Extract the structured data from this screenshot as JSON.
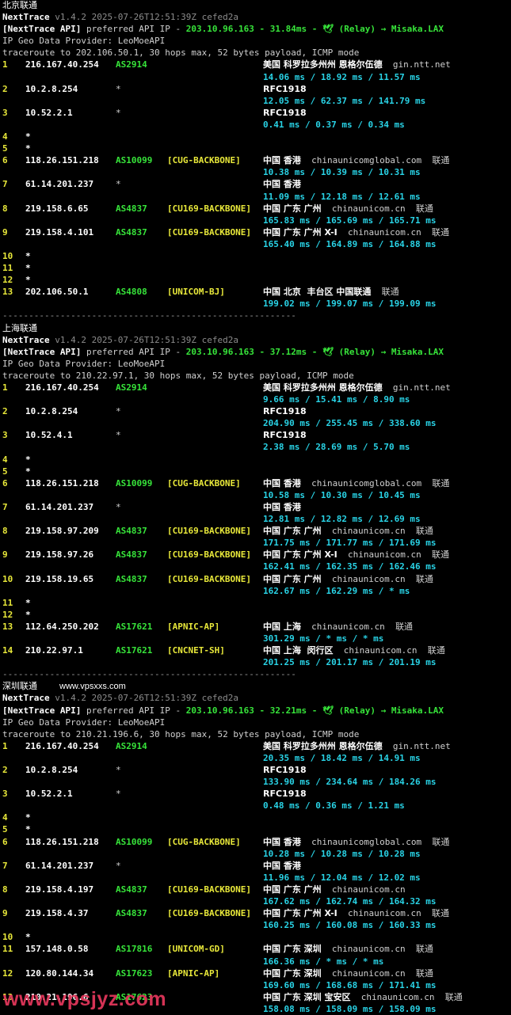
{
  "sections": [
    {
      "title": "北京联通",
      "version_name": "NextTrace",
      "version": "v1.4.2 2025-07-26T12:51:39Z cefed2a",
      "api_tag": "[NextTrace API]",
      "api_text": " preferred API IP - ",
      "api_ip": "203.10.96.163",
      "api_dash": " - ",
      "api_latency": "31.84ms",
      "api_relay": "🕊 (Relay) → Misaka.LAX",
      "geo_provider": "IP Geo Data Provider: LeoMoeAPI",
      "traceroute": "traceroute to 202.106.50.1, 30 hops max, 52 bytes payload, ICMP mode",
      "hops": [
        {
          "n": "1",
          "ip": "216.167.40.254",
          "asn": "AS2914",
          "tag": "",
          "geo": "美国 科罗拉多州州 恩格尔伍德",
          "domain": "gin.ntt.net",
          "isp": "",
          "rtt": "14.06 ms / 18.92 ms / 11.57 ms"
        },
        {
          "n": "2",
          "ip": "10.2.8.254",
          "asn": "*",
          "tag": "",
          "geo": "RFC1918",
          "domain": "",
          "isp": "",
          "rtt": "12.05 ms / 62.37 ms / 141.79 ms"
        },
        {
          "n": "3",
          "ip": "10.52.2.1",
          "asn": "*",
          "tag": "",
          "geo": "RFC1918",
          "domain": "",
          "isp": "",
          "rtt": "0.41 ms / 0.37 ms / 0.34 ms"
        },
        {
          "n": "4",
          "ip": "*"
        },
        {
          "n": "5",
          "ip": "*"
        },
        {
          "n": "6",
          "ip": "118.26.151.218",
          "asn": "AS10099",
          "tag": "[CUG-BACKBONE]",
          "geo": "中国 香港",
          "domain": "chinaunicomglobal.com",
          "isp": "联通",
          "rtt": "10.38 ms / 10.39 ms / 10.31 ms"
        },
        {
          "n": "7",
          "ip": "61.14.201.237",
          "asn": "*",
          "tag": "",
          "geo": "中国 香港",
          "domain": "",
          "isp": "",
          "rtt": "11.09 ms / 12.18 ms / 12.61 ms"
        },
        {
          "n": "8",
          "ip": "219.158.6.65",
          "asn": "AS4837",
          "tag": "[CU169-BACKBONE]",
          "geo": "中国 广东 广州",
          "domain": "chinaunicom.cn",
          "isp": "联通",
          "rtt": "165.83 ms / 165.69 ms / 165.71 ms"
        },
        {
          "n": "9",
          "ip": "219.158.4.101",
          "asn": "AS4837",
          "tag": "[CU169-BACKBONE]",
          "geo": "中国 广东 广州 X-I",
          "domain": "chinaunicom.cn",
          "isp": "联通",
          "rtt": "165.40 ms / 164.89 ms / 164.88 ms"
        },
        {
          "n": "10",
          "ip": "*"
        },
        {
          "n": "11",
          "ip": "*"
        },
        {
          "n": "12",
          "ip": "*"
        },
        {
          "n": "13",
          "ip": "202.106.50.1",
          "asn": "AS4808",
          "tag": "[UNICOM-BJ]",
          "geo": "中国 北京  丰台区 中国联通",
          "domain": "",
          "isp": "联通",
          "rtt": "199.02 ms / 199.07 ms / 199.09 ms"
        }
      ]
    },
    {
      "title": "上海联通",
      "version_name": "NextTrace",
      "version": "v1.4.2 2025-07-26T12:51:39Z cefed2a",
      "api_tag": "[NextTrace API]",
      "api_text": " preferred API IP - ",
      "api_ip": "203.10.96.163",
      "api_dash": " - ",
      "api_latency": "37.12ms",
      "api_relay": "🕊 (Relay) → Misaka.LAX",
      "geo_provider": "IP Geo Data Provider: LeoMoeAPI",
      "traceroute": "traceroute to 210.22.97.1, 30 hops max, 52 bytes payload, ICMP mode",
      "hops": [
        {
          "n": "1",
          "ip": "216.167.40.254",
          "asn": "AS2914",
          "tag": "",
          "geo": "美国 科罗拉多州州 恩格尔伍德",
          "domain": "gin.ntt.net",
          "isp": "",
          "rtt": "9.66 ms / 15.41 ms / 8.90 ms"
        },
        {
          "n": "2",
          "ip": "10.2.8.254",
          "asn": "*",
          "tag": "",
          "geo": "RFC1918",
          "domain": "",
          "isp": "",
          "rtt": "204.90 ms / 255.45 ms / 338.60 ms"
        },
        {
          "n": "3",
          "ip": "10.52.4.1",
          "asn": "*",
          "tag": "",
          "geo": "RFC1918",
          "domain": "",
          "isp": "",
          "rtt": "2.38 ms / 28.69 ms / 5.70 ms"
        },
        {
          "n": "4",
          "ip": "*"
        },
        {
          "n": "5",
          "ip": "*"
        },
        {
          "n": "6",
          "ip": "118.26.151.218",
          "asn": "AS10099",
          "tag": "[CUG-BACKBONE]",
          "geo": "中国 香港",
          "domain": "chinaunicomglobal.com",
          "isp": "联通",
          "rtt": "10.58 ms / 10.30 ms / 10.45 ms"
        },
        {
          "n": "7",
          "ip": "61.14.201.237",
          "asn": "*",
          "tag": "",
          "geo": "中国 香港",
          "domain": "",
          "isp": "",
          "rtt": "12.81 ms / 12.82 ms / 12.69 ms"
        },
        {
          "n": "8",
          "ip": "219.158.97.209",
          "asn": "AS4837",
          "tag": "[CU169-BACKBONE]",
          "geo": "中国 广东 广州",
          "domain": "chinaunicom.cn",
          "isp": "联通",
          "rtt": "171.75 ms / 171.77 ms / 171.69 ms"
        },
        {
          "n": "9",
          "ip": "219.158.97.26",
          "asn": "AS4837",
          "tag": "[CU169-BACKBONE]",
          "geo": "中国 广东 广州 X-I",
          "domain": "chinaunicom.cn",
          "isp": "联通",
          "rtt": "162.41 ms / 162.35 ms / 162.46 ms"
        },
        {
          "n": "10",
          "ip": "219.158.19.65",
          "asn": "AS4837",
          "tag": "[CU169-BACKBONE]",
          "geo": "中国 广东 广州",
          "domain": "chinaunicom.cn",
          "isp": "联通",
          "rtt": "162.67 ms / 162.29 ms / * ms"
        },
        {
          "n": "11",
          "ip": "*"
        },
        {
          "n": "12",
          "ip": "*"
        },
        {
          "n": "13",
          "ip": "112.64.250.202",
          "asn": "AS17621",
          "tag": "[APNIC-AP]",
          "geo": "中国 上海",
          "domain": "chinaunicom.cn",
          "isp": "联通",
          "rtt": "301.29 ms / * ms / * ms"
        },
        {
          "n": "14",
          "ip": "210.22.97.1",
          "asn": "AS17621",
          "tag": "[CNCNET-SH]",
          "geo": "中国 上海  闵行区",
          "domain": "chinaunicom.cn",
          "isp": "联通",
          "rtt": "201.25 ms / 201.17 ms / 201.19 ms"
        }
      ]
    },
    {
      "title": "深圳联通",
      "version_name": "NextTrace",
      "version": "v1.4.2 2025-07-26T12:51:39Z cefed2a",
      "api_tag": "[NextTrace API]",
      "api_text": " preferred API IP - ",
      "api_ip": "203.10.96.163",
      "api_dash": " - ",
      "api_latency": "32.21ms",
      "api_relay": "🕊 (Relay) → Misaka.LAX",
      "geo_provider": "IP Geo Data Provider: LeoMoeAPI",
      "traceroute": "traceroute to 210.21.196.6, 30 hops max, 52 bytes payload, ICMP mode",
      "hops": [
        {
          "n": "1",
          "ip": "216.167.40.254",
          "asn": "AS2914",
          "tag": "",
          "geo": "美国 科罗拉多州州 恩格尔伍德",
          "domain": "gin.ntt.net",
          "isp": "",
          "rtt": "20.35 ms / 18.42 ms / 14.91 ms"
        },
        {
          "n": "2",
          "ip": "10.2.8.254",
          "asn": "*",
          "tag": "",
          "geo": "RFC1918",
          "domain": "",
          "isp": "",
          "rtt": "133.90 ms / 234.64 ms / 184.26 ms"
        },
        {
          "n": "3",
          "ip": "10.52.2.1",
          "asn": "*",
          "tag": "",
          "geo": "RFC1918",
          "domain": "",
          "isp": "",
          "rtt": "0.48 ms / 0.36 ms / 1.21 ms"
        },
        {
          "n": "4",
          "ip": "*"
        },
        {
          "n": "5",
          "ip": "*"
        },
        {
          "n": "6",
          "ip": "118.26.151.218",
          "asn": "AS10099",
          "tag": "[CUG-BACKBONE]",
          "geo": "中国 香港",
          "domain": "chinaunicomglobal.com",
          "isp": "联通",
          "rtt": "10.28 ms / 10.28 ms / 10.28 ms"
        },
        {
          "n": "7",
          "ip": "61.14.201.237",
          "asn": "*",
          "tag": "",
          "geo": "中国 香港",
          "domain": "",
          "isp": "",
          "rtt": "11.96 ms / 12.04 ms / 12.02 ms"
        },
        {
          "n": "8",
          "ip": "219.158.4.197",
          "asn": "AS4837",
          "tag": "[CU169-BACKBONE]",
          "geo": "中国 广东 广州",
          "domain": "chinaunicom.cn",
          "isp": "",
          "rtt": "167.62 ms / 162.74 ms / 164.32 ms"
        },
        {
          "n": "9",
          "ip": "219.158.4.37",
          "asn": "AS4837",
          "tag": "[CU169-BACKBONE]",
          "geo": "中国 广东 广州 X-I",
          "domain": "chinaunicom.cn",
          "isp": "联通",
          "rtt": "160.25 ms / 160.08 ms / 160.33 ms"
        },
        {
          "n": "10",
          "ip": "*"
        },
        {
          "n": "11",
          "ip": "157.148.0.58",
          "asn": "AS17816",
          "tag": "[UNICOM-GD]",
          "geo": "中国 广东 深圳",
          "domain": "chinaunicom.cn",
          "isp": "联通",
          "rtt": "166.36 ms / * ms / * ms"
        },
        {
          "n": "12",
          "ip": "120.80.144.34",
          "asn": "AS17623",
          "tag": "[APNIC-AP]",
          "geo": "中国 广东 深圳",
          "domain": "chinaunicom.cn",
          "isp": "联通",
          "rtt": "169.60 ms / 168.68 ms / 171.41 ms"
        },
        {
          "n": "13",
          "ip": "210.21.196.6",
          "asn": "AS17623",
          "tag": "",
          "geo": "中国 广东 深圳 宝安区",
          "domain": "chinaunicom.cn",
          "isp": "联通",
          "rtt": "158.08 ms / 158.09 ms / 158.09 ms"
        }
      ]
    }
  ],
  "separator": "--------------------------------------------------------",
  "watermark_small": "www.vpsxxs.com",
  "watermark_large": "www.vpsjyz.com",
  "colors": {
    "background": "#000000",
    "yellow": "#e8e83a",
    "green": "#37e43a",
    "cyan": "#29d3e6",
    "white": "#ffffff",
    "gray": "#8c8c8c"
  }
}
